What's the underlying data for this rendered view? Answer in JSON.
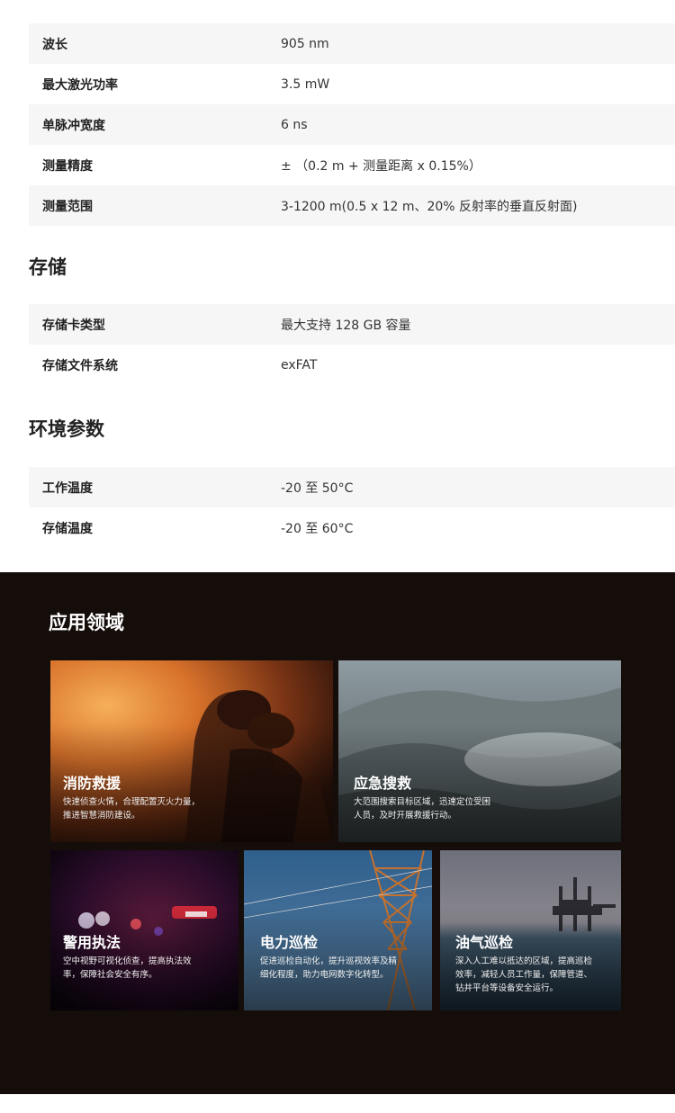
{
  "laser_specs": [
    {
      "label": "波长",
      "value": "905 nm"
    },
    {
      "label": "最大激光功率",
      "value": "3.5 mW"
    },
    {
      "label": "单脉冲宽度",
      "value": "6 ns"
    },
    {
      "label": "测量精度",
      "value": "±  （0.2 m + 测量距离 x 0.15%）"
    },
    {
      "label": "测量范围",
      "value": "3-1200 m(0.5 x 12 m、20% 反射率的垂直反射面)"
    }
  ],
  "storage": {
    "title": "存储",
    "rows": [
      {
        "label": "存储卡类型",
        "value": "最大支持 128 GB 容量"
      },
      {
        "label": "存储文件系统",
        "value": "exFAT"
      }
    ]
  },
  "environment": {
    "title": "环境参数",
    "rows": [
      {
        "label": "工作温度",
        "value": "-20 至 50°C"
      },
      {
        "label": "存储温度",
        "value": "-20 至 60°C"
      }
    ]
  },
  "applications": {
    "title": "应用领域",
    "cards": [
      {
        "title": "消防救援",
        "desc_line1": "快速侦查火情，合理配置灭火力量，",
        "desc_line2": "推进智慧消防建设。",
        "desc_line3": ""
      },
      {
        "title": "应急搜救",
        "desc_line1": "大范围搜索目标区域，迅速定位受困",
        "desc_line2": "人员，及时开展救援行动。",
        "desc_line3": ""
      },
      {
        "title": "警用执法",
        "desc_line1": "空中视野可视化侦查，提高执法效",
        "desc_line2": "率，保障社会安全有序。",
        "desc_line3": ""
      },
      {
        "title": "电力巡检",
        "desc_line1": "促进巡检自动化，提升巡视效率及精",
        "desc_line2": "细化程度，助力电网数字化转型。",
        "desc_line3": ""
      },
      {
        "title": "油气巡检",
        "desc_line1": "深入人工难以抵达的区域，提高巡检",
        "desc_line2": "效率，减轻人员工作量，保障管道、",
        "desc_line3": "钻井平台等设备安全运行。"
      }
    ]
  }
}
